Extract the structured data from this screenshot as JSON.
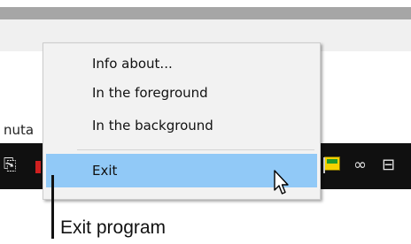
{
  "background": {
    "partial_text": "nuta"
  },
  "context_menu": {
    "items": [
      {
        "label": "Info about..."
      },
      {
        "label": "In the foreground"
      },
      {
        "label": "In the background"
      }
    ],
    "exit_label": "Exit",
    "highlight_color": "#91c9f7"
  },
  "callout": {
    "text": "Exit program"
  },
  "taskbar": {
    "icons": [
      "tray-icon",
      "red-app-icon",
      "flag-icon",
      "link-icon",
      "network-icon"
    ]
  }
}
